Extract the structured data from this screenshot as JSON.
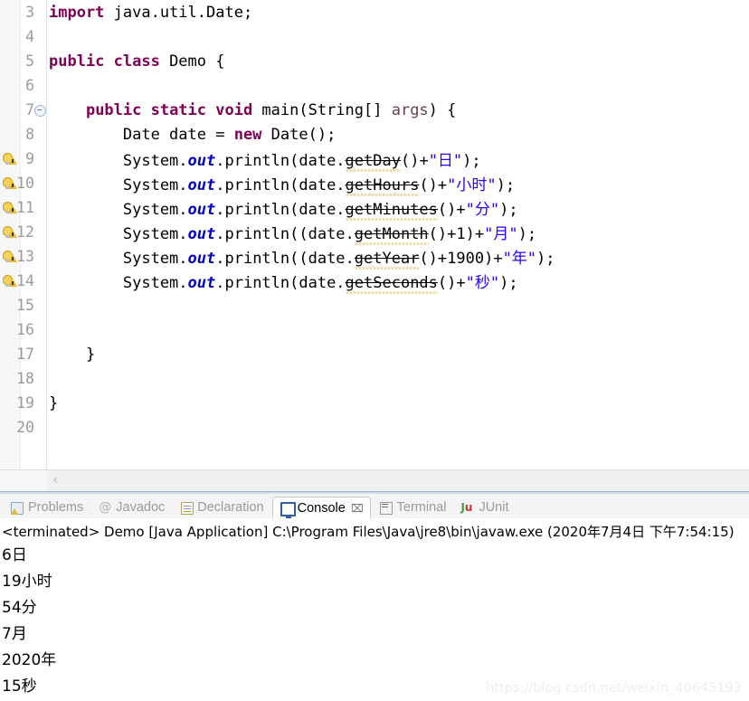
{
  "editor": {
    "lines": [
      {
        "num": "3",
        "marker": "none",
        "fold": false,
        "segments": [
          {
            "text": "import ",
            "style": "kw"
          },
          {
            "text": "java.util.Date;",
            "style": "plain"
          }
        ]
      },
      {
        "num": "4",
        "marker": "none",
        "fold": false,
        "segments": []
      },
      {
        "num": "5",
        "marker": "none",
        "fold": false,
        "segments": [
          {
            "text": "public class ",
            "style": "kw"
          },
          {
            "text": "Demo {",
            "style": "plain"
          }
        ]
      },
      {
        "num": "6",
        "marker": "none",
        "fold": false,
        "segments": []
      },
      {
        "num": "7",
        "marker": "none",
        "fold": true,
        "segments": [
          {
            "text": "    ",
            "style": "plain"
          },
          {
            "text": "public static void ",
            "style": "kw"
          },
          {
            "text": "main(String[] ",
            "style": "plain"
          },
          {
            "text": "args",
            "style": "var"
          },
          {
            "text": ") {",
            "style": "plain"
          }
        ]
      },
      {
        "num": "8",
        "marker": "none",
        "fold": false,
        "segments": [
          {
            "text": "        Date date = ",
            "style": "plain"
          },
          {
            "text": "new ",
            "style": "kw"
          },
          {
            "text": "Date();",
            "style": "plain"
          }
        ]
      },
      {
        "num": "9",
        "marker": "warning",
        "fold": false,
        "segments": [
          {
            "text": "        System.",
            "style": "plain"
          },
          {
            "text": "out",
            "style": "fld"
          },
          {
            "text": ".println(date.",
            "style": "plain"
          },
          {
            "text": "getDay",
            "style": "deprecated"
          },
          {
            "text": "()+",
            "style": "plain"
          },
          {
            "text": "\"日\"",
            "style": "str"
          },
          {
            "text": ");",
            "style": "plain"
          }
        ]
      },
      {
        "num": "10",
        "marker": "warning",
        "fold": false,
        "segments": [
          {
            "text": "        System.",
            "style": "plain"
          },
          {
            "text": "out",
            "style": "fld"
          },
          {
            "text": ".println(date.",
            "style": "plain"
          },
          {
            "text": "getHours",
            "style": "deprecated"
          },
          {
            "text": "()+",
            "style": "plain"
          },
          {
            "text": "\"小时\"",
            "style": "str"
          },
          {
            "text": ");",
            "style": "plain"
          }
        ]
      },
      {
        "num": "11",
        "marker": "warning",
        "fold": false,
        "segments": [
          {
            "text": "        System.",
            "style": "plain"
          },
          {
            "text": "out",
            "style": "fld"
          },
          {
            "text": ".println(date.",
            "style": "plain"
          },
          {
            "text": "getMinutes",
            "style": "deprecated"
          },
          {
            "text": "()+",
            "style": "plain"
          },
          {
            "text": "\"分\"",
            "style": "str"
          },
          {
            "text": ");",
            "style": "plain"
          }
        ]
      },
      {
        "num": "12",
        "marker": "warning",
        "fold": false,
        "segments": [
          {
            "text": "        System.",
            "style": "plain"
          },
          {
            "text": "out",
            "style": "fld"
          },
          {
            "text": ".println((date.",
            "style": "plain"
          },
          {
            "text": "getMonth",
            "style": "deprecated"
          },
          {
            "text": "()+1)+",
            "style": "plain"
          },
          {
            "text": "\"月\"",
            "style": "str"
          },
          {
            "text": ");",
            "style": "plain"
          }
        ]
      },
      {
        "num": "13",
        "marker": "warning",
        "fold": false,
        "segments": [
          {
            "text": "        System.",
            "style": "plain"
          },
          {
            "text": "out",
            "style": "fld"
          },
          {
            "text": ".println((date.",
            "style": "plain"
          },
          {
            "text": "getYear",
            "style": "deprecated"
          },
          {
            "text": "()+1900)+",
            "style": "plain"
          },
          {
            "text": "\"年\"",
            "style": "str"
          },
          {
            "text": ");",
            "style": "plain"
          }
        ]
      },
      {
        "num": "14",
        "marker": "warning",
        "fold": false,
        "segments": [
          {
            "text": "        System.",
            "style": "plain"
          },
          {
            "text": "out",
            "style": "fld"
          },
          {
            "text": ".println(date.",
            "style": "plain"
          },
          {
            "text": "getSeconds",
            "style": "deprecated"
          },
          {
            "text": "()+",
            "style": "plain"
          },
          {
            "text": "\"秒\"",
            "style": "str"
          },
          {
            "text": ");",
            "style": "plain"
          }
        ]
      },
      {
        "num": "15",
        "marker": "none",
        "fold": false,
        "segments": []
      },
      {
        "num": "16",
        "marker": "none",
        "fold": false,
        "segments": []
      },
      {
        "num": "17",
        "marker": "none",
        "fold": false,
        "segments": [
          {
            "text": "    }",
            "style": "plain"
          }
        ]
      },
      {
        "num": "18",
        "marker": "none",
        "fold": false,
        "segments": []
      },
      {
        "num": "19",
        "marker": "none",
        "fold": false,
        "segments": [
          {
            "text": "}",
            "style": "plain"
          }
        ]
      },
      {
        "num": "20",
        "marker": "none",
        "fold": false,
        "segments": []
      }
    ],
    "scrollbar": {
      "left_arrow": "‹"
    },
    "colors": {
      "keyword": "#7f0055",
      "string": "#2a00ff",
      "field": "#0000c0",
      "local_var": "#6a3e53",
      "deprecated_underline": "#d6a01b",
      "line_number": "#9b9b9b"
    }
  },
  "tabbar": {
    "tabs": [
      {
        "label": "Problems",
        "icon": "problems-icon",
        "active": false,
        "closable": false
      },
      {
        "label": "Javadoc",
        "icon": "javadoc-icon",
        "active": false,
        "closable": false
      },
      {
        "label": "Declaration",
        "icon": "declaration-icon",
        "active": false,
        "closable": false
      },
      {
        "label": "Console",
        "icon": "console-icon",
        "active": true,
        "closable": true
      },
      {
        "label": "Terminal",
        "icon": "terminal-icon",
        "active": false,
        "closable": false
      },
      {
        "label": "JUnit",
        "icon": "junit-icon",
        "active": false,
        "closable": false
      }
    ],
    "close_glyph": "⌧",
    "javadoc_glyph": "@"
  },
  "console": {
    "status_line": "<terminated> Demo [Java Application] C:\\Program Files\\Java\\jre8\\bin\\javaw.exe (2020年7月4日 下午7:54:15)",
    "output": [
      "6日",
      "19小时",
      "54分",
      "7月",
      "2020年",
      "15秒"
    ]
  },
  "watermark": "https://blog.csdn.net/weixin_40645193"
}
